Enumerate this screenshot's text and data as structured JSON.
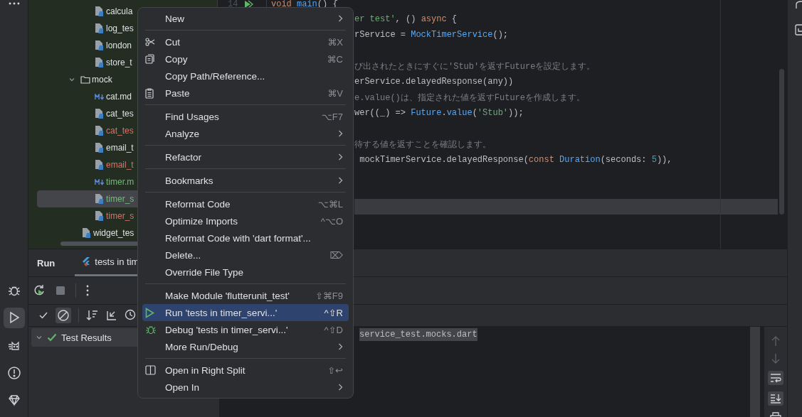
{
  "left_toolbar": [
    {
      "selected": false
    },
    {
      "selected": true
    },
    {
      "selected": false
    },
    {
      "selected": false
    },
    {
      "selected": false
    }
  ],
  "project_tree": {
    "partial_children": [
      {
        "name": "calcula",
        "kind": "dart-file",
        "color": "#dfe1e5",
        "selected": false
      },
      {
        "name": "log_tes",
        "kind": "dart-file",
        "color": "#dfe1e5",
        "selected": false
      },
      {
        "name": "london",
        "kind": "dart-file",
        "color": "#dfe1e5",
        "selected": false
      },
      {
        "name": "store_t",
        "kind": "dart-file",
        "color": "#dfe1e5",
        "selected": false
      }
    ],
    "items": [
      {
        "name": "mock",
        "kind": "folder",
        "expanded": true,
        "color": "#dfe1e5",
        "selected": false,
        "children": [
          {
            "name": "cat.md",
            "kind": "markdown-file",
            "color": "#dfe1e5",
            "selected": false
          },
          {
            "name": "cat_tes",
            "kind": "dart-file",
            "color": "#dfe1e5",
            "selected": false
          },
          {
            "name": "cat_tes",
            "kind": "dart-file",
            "color": "#d5756c",
            "selected": false
          },
          {
            "name": "email_t",
            "kind": "dart-file",
            "color": "#dfe1e5",
            "selected": false
          },
          {
            "name": "email_t",
            "kind": "dart-file",
            "color": "#d5756c",
            "selected": false
          },
          {
            "name": "timer.m",
            "kind": "markdown-file",
            "color": "#73bd79",
            "selected": false
          },
          {
            "name": "timer_s",
            "kind": "dart-file",
            "color": "#73bd79",
            "selected": true
          },
          {
            "name": "timer_s",
            "kind": "dart-file",
            "color": "#d5756c",
            "selected": false
          }
        ]
      },
      {
        "name": "widget_tes",
        "kind": "dart-file",
        "color": "#dfe1e5",
        "selected": false
      }
    ]
  },
  "editor": {
    "lines": [
      {
        "number": "14",
        "run_gutter": true,
        "current": false,
        "tokens": [
          {
            "text": "void ",
            "kind": "keyword"
          },
          {
            "text": "main",
            "kind": "function"
          },
          {
            "text": "() {",
            "kind": "plain"
          }
        ]
      },
      {
        "current": false,
        "tokens": [
          {
            "text": "er test'",
            "kind": "string"
          },
          {
            "text": ", () ",
            "kind": "plain"
          },
          {
            "text": "async",
            "kind": "keyword"
          },
          {
            "text": " {",
            "kind": "plain"
          }
        ]
      },
      {
        "current": false,
        "tokens": [
          {
            "text": "rService = ",
            "kind": "plain"
          },
          {
            "text": "MockTimerService",
            "kind": "type"
          },
          {
            "text": "();",
            "kind": "plain"
          }
        ]
      },
      {
        "current": false
      },
      {
        "current": false,
        "tokens": [
          {
            "text": "び出されたときにすぐに'Stub'を返すFutureを設定します。",
            "kind": "comment"
          }
        ]
      },
      {
        "current": false,
        "tokens": [
          {
            "text": "erService.delayedResponse(any))",
            "kind": "plain"
          }
        ]
      },
      {
        "current": false,
        "tokens": [
          {
            "text": "e.value()は、指定された値を返すFutureを作成します。",
            "kind": "comment"
          }
        ]
      },
      {
        "current": false,
        "tokens": [
          {
            "text": "wer((_) => ",
            "kind": "plain"
          },
          {
            "text": "Future",
            "kind": "type"
          },
          {
            "text": ".",
            "kind": "plain"
          },
          {
            "text": "value",
            "kind": "function"
          },
          {
            "text": "(",
            "kind": "plain"
          },
          {
            "text": "'Stub'",
            "kind": "string"
          },
          {
            "text": "));",
            "kind": "plain"
          }
        ]
      },
      {
        "current": false
      },
      {
        "current": false,
        "tokens": [
          {
            "text": "待する値を返すことを確認します。",
            "kind": "comment"
          }
        ]
      },
      {
        "current": false,
        "tokens": [
          {
            "text": " mockTimerService.delayedResponse(",
            "kind": "plain"
          },
          {
            "text": "const ",
            "kind": "keyword"
          },
          {
            "text": "Duration",
            "kind": "type"
          },
          {
            "text": "(seconds: ",
            "kind": "plain"
          },
          {
            "text": "5",
            "kind": "number"
          },
          {
            "text": ")),",
            "kind": "plain"
          }
        ]
      },
      {
        "current": false
      },
      {
        "current": false
      },
      {
        "current": true
      }
    ]
  },
  "bottom_panel": {
    "title": "Run",
    "tabs": [
      {
        "label": "tests in tim",
        "selected": true
      }
    ],
    "test_tree": [
      {
        "label": "Test Results",
        "passed": true,
        "expanded": true,
        "selected": true
      }
    ],
    "console": [
      {
        "text": "service_test.mocks.dart",
        "highlighted": true
      }
    ]
  },
  "context_menu": [
    {
      "kind": "item",
      "label": "New",
      "submenu": true,
      "selected": false
    },
    {
      "kind": "separator"
    },
    {
      "kind": "item",
      "label": "Cut",
      "shortcut": "⌘X",
      "selected": false
    },
    {
      "kind": "item",
      "label": "Copy",
      "shortcut": "⌘C",
      "selected": false
    },
    {
      "kind": "item",
      "label": "Copy Path/Reference...",
      "selected": false
    },
    {
      "kind": "item",
      "label": "Paste",
      "shortcut": "⌘V",
      "selected": false
    },
    {
      "kind": "separator"
    },
    {
      "kind": "item",
      "label": "Find Usages",
      "shortcut": "⌥F7",
      "selected": false
    },
    {
      "kind": "item",
      "label": "Analyze",
      "submenu": true,
      "selected": false
    },
    {
      "kind": "separator"
    },
    {
      "kind": "item",
      "label": "Refactor",
      "submenu": true,
      "selected": false
    },
    {
      "kind": "separator"
    },
    {
      "kind": "item",
      "label": "Bookmarks",
      "submenu": true,
      "selected": false
    },
    {
      "kind": "separator"
    },
    {
      "kind": "item",
      "label": "Reformat Code",
      "shortcut": "⌥⌘L",
      "selected": false
    },
    {
      "kind": "item",
      "label": "Optimize Imports",
      "shortcut": "^⌥O",
      "selected": false
    },
    {
      "kind": "item",
      "label": "Reformat Code with 'dart format'...",
      "selected": false
    },
    {
      "kind": "item",
      "label": "Delete...",
      "shortcut": "⌦",
      "selected": false
    },
    {
      "kind": "item",
      "label": "Override File Type",
      "selected": false
    },
    {
      "kind": "separator"
    },
    {
      "kind": "item",
      "label": "Make Module 'flutterunit_test'",
      "shortcut": "⇧⌘F9",
      "selected": false
    },
    {
      "kind": "item",
      "label": "Run 'tests in timer_servi...'",
      "shortcut": "^⇧R",
      "selected": true
    },
    {
      "kind": "item",
      "label": "Debug 'tests in timer_servi...'",
      "shortcut": "^⇧D",
      "selected": false
    },
    {
      "kind": "item",
      "label": "More Run/Debug",
      "submenu": true,
      "selected": false
    },
    {
      "kind": "separator"
    },
    {
      "kind": "item",
      "label": "Open in Right Split",
      "shortcut": "⇧↩",
      "selected": false
    },
    {
      "kind": "item",
      "label": "Open In",
      "submenu": true,
      "selected": false
    }
  ]
}
